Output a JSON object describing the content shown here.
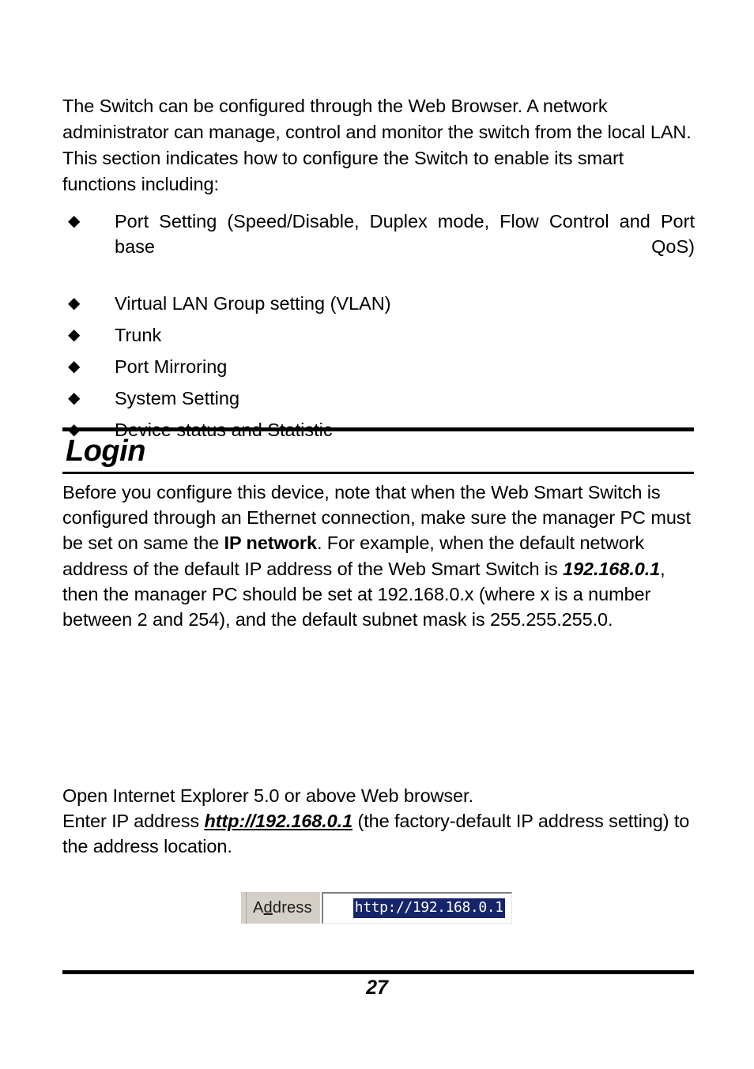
{
  "document": {
    "intro_paragraph": "The Switch can be configured through the Web Browser. A network administrator can manage, control and monitor the switch from the local LAN. This section indicates how to configure the Switch to enable its smart functions including:",
    "bullet_marker": "◆",
    "feature_bullets": [
      "Port Setting (Speed/Disable, Duplex mode, Flow Control and Port base QoS)",
      "Virtual LAN Group setting (VLAN)",
      "Trunk",
      "Port Mirroring",
      "System Setting",
      "Device status and Statistic"
    ],
    "section": {
      "heading": "Login",
      "paragraph_1": {
        "part_1": "Before you configure this device, note that when the Web Smart Switch is configured through an Ethernet connection, make sure the manager PC must be set on same the ",
        "emphasis_1": "IP network",
        "part_2": ". For example, when the default network address of the default IP address of the Web Smart Switch is ",
        "emphasis_2": "192.168.0.1",
        "part_3": ", then the manager PC should be set at 192.168.0.x (where x is a number between 2 and 254), and the default subnet mask is 255.255.255.0."
      },
      "paragraph_2": {
        "line_1": "Open Internet Explorer 5.0 or above Web browser.",
        "part_1": "Enter IP address ",
        "link": "http://192.168.0.1",
        "part_2": " (the factory-default IP address setting) to the address location."
      }
    },
    "address_bar_figure": {
      "label_prefix": "A",
      "label_accelerator": "d",
      "label_suffix": "dress",
      "url_value": "http://192.168.0.1",
      "selection_color": "#16256b",
      "chrome_color": "#d4d0c8"
    },
    "footer": {
      "page_number": "27"
    }
  }
}
